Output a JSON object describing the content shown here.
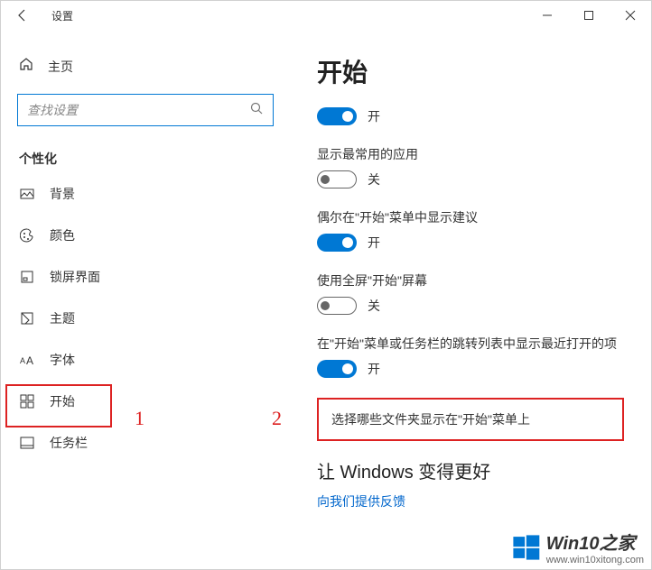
{
  "titlebar": {
    "title": "设置"
  },
  "sidebar": {
    "home": "主页",
    "search_placeholder": "查找设置",
    "category": "个性化",
    "items": [
      {
        "label": "背景"
      },
      {
        "label": "颜色"
      },
      {
        "label": "锁屏界面"
      },
      {
        "label": "主题"
      },
      {
        "label": "字体"
      },
      {
        "label": "开始"
      },
      {
        "label": "任务栏"
      }
    ]
  },
  "content": {
    "heading": "开始",
    "toggles": [
      {
        "label": "",
        "state": "on",
        "text": "开"
      },
      {
        "label": "显示最常用的应用",
        "state": "off",
        "text": "关"
      },
      {
        "label": "偶尔在\"开始\"菜单中显示建议",
        "state": "on",
        "text": "开"
      },
      {
        "label": "使用全屏\"开始\"屏幕",
        "state": "off",
        "text": "关"
      },
      {
        "label": "在\"开始\"菜单或任务栏的跳转列表中显示最近打开的项",
        "state": "on",
        "text": "开"
      }
    ],
    "folder_link": "选择哪些文件夹显示在\"开始\"菜单上",
    "better_heading": "让 Windows 变得更好",
    "feedback": "向我们提供反馈"
  },
  "annotations": {
    "num1": "1",
    "num2": "2"
  },
  "watermark": {
    "brand": "Win10之家",
    "url": "www.win10xitong.com"
  }
}
